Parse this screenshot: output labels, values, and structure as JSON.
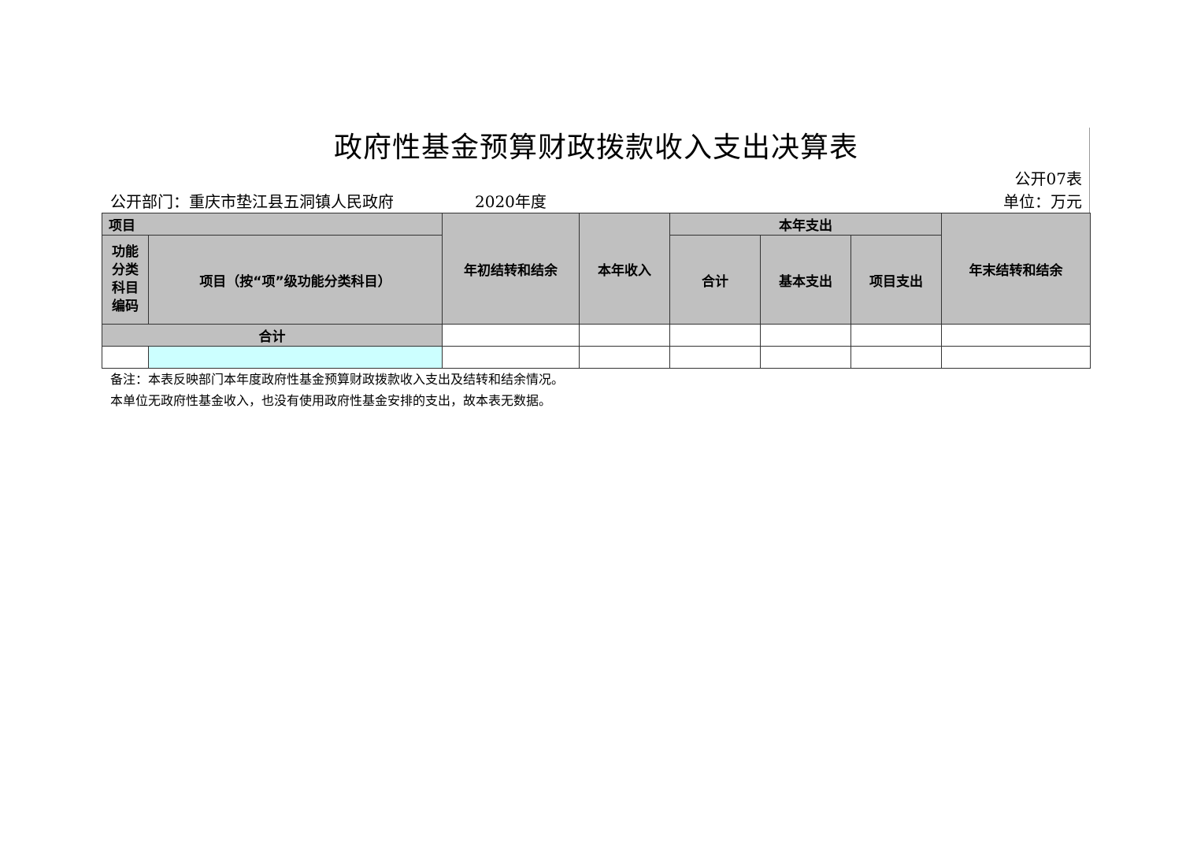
{
  "title": "政府性基金预算财政拨款收入支出决算表",
  "form_no": "公开07表",
  "department": "公开部门：重庆市垫江县五洞镇人民政府",
  "year": "2020年度",
  "unit": "单位：万元",
  "table": {
    "header_project": "项目",
    "header_code": "功能\n分类\n科目\n编码",
    "header_item": "项目（按“项”级功能分类科目）",
    "header_begin_balance": "年初结转和结余",
    "header_income": "本年收入",
    "header_expense_group": "本年支出",
    "header_total": "合计",
    "header_basic": "基本支出",
    "header_project_exp": "项目支出",
    "header_end_balance": "年末结转和结余",
    "total_row_label": "合计",
    "total_row_values": [
      "",
      "",
      "",
      "",
      "",
      ""
    ],
    "data_rows": [
      {
        "code": "",
        "item": "",
        "values": [
          "",
          "",
          "",
          "",
          "",
          ""
        ]
      }
    ]
  },
  "notes": [
    "备注：本表反映部门本年度政府性基金预算财政拨款收入支出及结转和结余情况。",
    "本单位无政府性基金收入，也没有使用政府性基金安排的支出，故本表无数据。"
  ]
}
